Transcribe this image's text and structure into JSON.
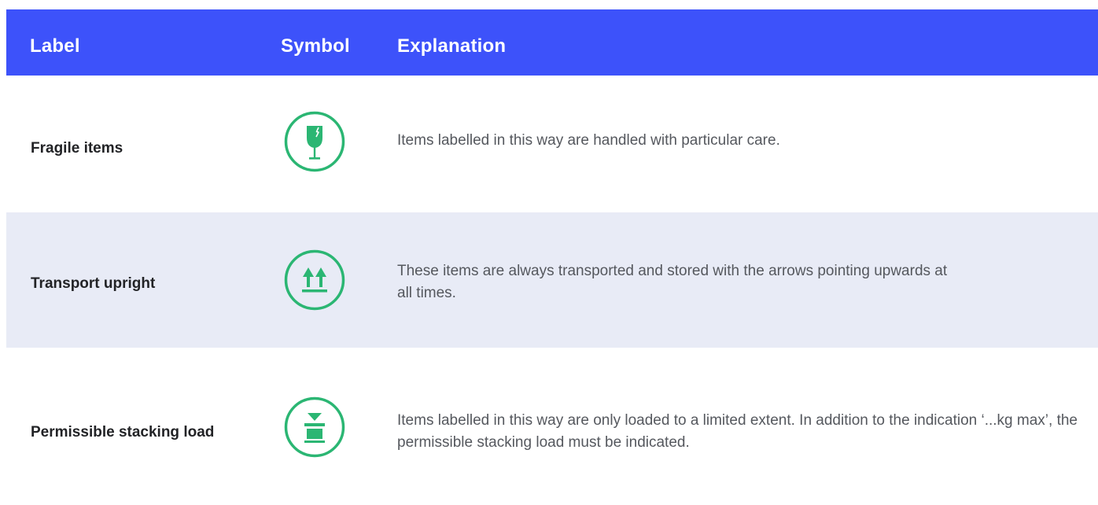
{
  "table": {
    "headers": {
      "label": "Label",
      "symbol": "Symbol",
      "explanation": "Explanation"
    },
    "rows": [
      {
        "label": "Fragile items",
        "symbol_icon": "fragile-glass-icon",
        "explanation": "Items labelled in this way are handled with particular care."
      },
      {
        "label": "Transport upright",
        "symbol_icon": "this-way-up-arrows-icon",
        "explanation": "These items are always transported and stored with the arrows pointing upwards at all times."
      },
      {
        "label": "Permissible stacking load",
        "symbol_icon": "stacking-load-icon",
        "explanation": "Items labelled in this way are only loaded to a limited extent. In addition to the indication ‘...kg max’, the permissible stacking load must be indicated."
      }
    ]
  },
  "colors": {
    "header_bg": "#3d52fa",
    "header_text": "#ffffff",
    "alt_row_bg": "#e8ebf6",
    "icon_green": "#2bb673"
  }
}
